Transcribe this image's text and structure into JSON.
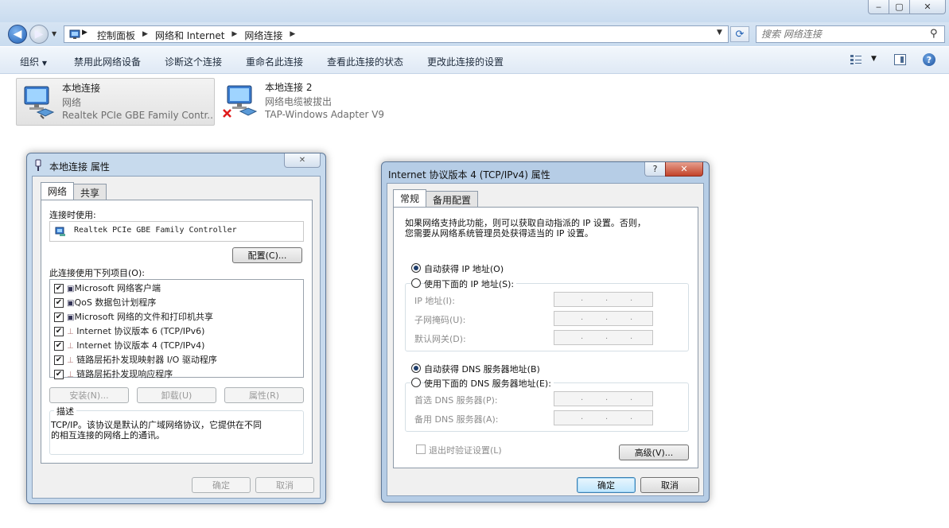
{
  "explorer": {
    "address": {
      "crumbs": [
        "控制面板",
        "网络和 Internet",
        "网络连接"
      ],
      "search_placeholder": "搜索 网络连接"
    },
    "commands": [
      "组织",
      "禁用此网络设备",
      "诊断这个连接",
      "重命名此连接",
      "查看此连接的状态",
      "更改此连接的设置"
    ],
    "connections": [
      {
        "name": "本地连接",
        "status": "网络",
        "adapter": "Realtek PCIe GBE Family Contr..."
      },
      {
        "name": "本地连接 2",
        "status": "网络电缆被拔出",
        "adapter": "TAP-Windows Adapter V9"
      }
    ]
  },
  "props_dialog": {
    "title": "本地连接 属性",
    "tabs": [
      "网络",
      "共享"
    ],
    "connect_using_label": "连接时使用:",
    "adapter_name": "Realtek PCIe GBE Family Controller",
    "configure_button": "配置(C)...",
    "items_label": "此连接使用下列项目(O):",
    "items": [
      "Microsoft 网络客户端",
      "QoS 数据包计划程序",
      "Microsoft 网络的文件和打印机共享",
      "Internet 协议版本 6 (TCP/IPv6)",
      "Internet 协议版本 4 (TCP/IPv4)",
      "链路层拓扑发现映射器 I/O 驱动程序",
      "链路层拓扑发现响应程序"
    ],
    "install_button": "安装(N)...",
    "uninstall_button": "卸载(U)",
    "properties_button": "属性(R)",
    "description_label": "描述",
    "description_line1": "TCP/IP。该协议是默认的广域网络协议，它提供在不同",
    "description_line2": "的相互连接的网络上的通讯。",
    "ok_button": "确定",
    "cancel_button": "取消"
  },
  "ipv4_dialog": {
    "title": "Internet 协议版本 4 (TCP/IPv4) 属性",
    "help_glyph": "?",
    "tabs": [
      "常规",
      "备用配置"
    ],
    "intro_line1": "如果网络支持此功能，则可以获取自动指派的 IP 设置。否则，",
    "intro_line2": "您需要从网络系统管理员处获得适当的 IP 设置。",
    "auto_ip": "自动获得 IP 地址(O)",
    "manual_ip": "使用下面的 IP 地址(S):",
    "ip_address_label": "IP 地址(I):",
    "subnet_label": "子网掩码(U):",
    "gateway_label": "默认网关(D):",
    "auto_dns": "自动获得 DNS 服务器地址(B)",
    "manual_dns": "使用下面的 DNS 服务器地址(E):",
    "preferred_dns_label": "首选 DNS 服务器(P):",
    "alternate_dns_label": "备用 DNS 服务器(A):",
    "validate_label": "退出时验证设置(L)",
    "advanced_button": "高级(V)...",
    "ok_button": "确定",
    "cancel_button": "取消",
    "selected_ip_mode": "auto",
    "selected_dns_mode": "auto"
  }
}
